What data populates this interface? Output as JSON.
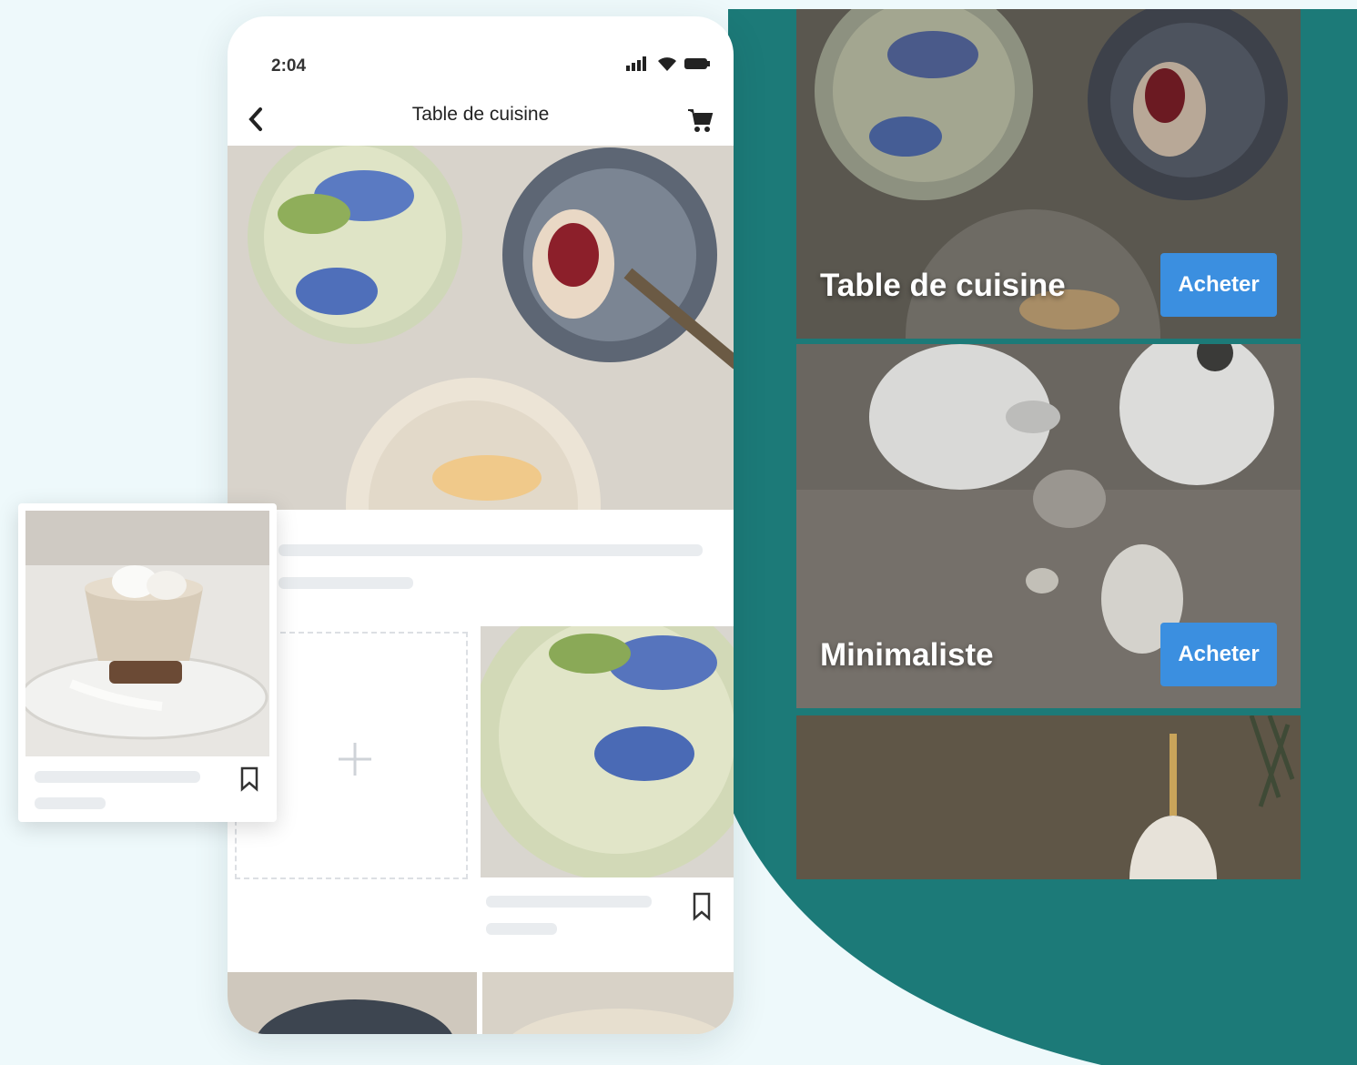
{
  "phone": {
    "status_time": "2:04",
    "nav_title": "Table de cuisine"
  },
  "panels": [
    {
      "title": "Table de cuisine",
      "button": "Acheter"
    },
    {
      "title": "Minimaliste",
      "button": "Acheter"
    }
  ],
  "colors": {
    "teal": "#1c7a78",
    "button_blue": "#3b8fe0",
    "background": "#eef9fb"
  },
  "icons": [
    "back-chevron-icon",
    "cart-icon",
    "signal-icon",
    "wifi-icon",
    "battery-icon",
    "plus-icon",
    "bookmark-icon"
  ]
}
